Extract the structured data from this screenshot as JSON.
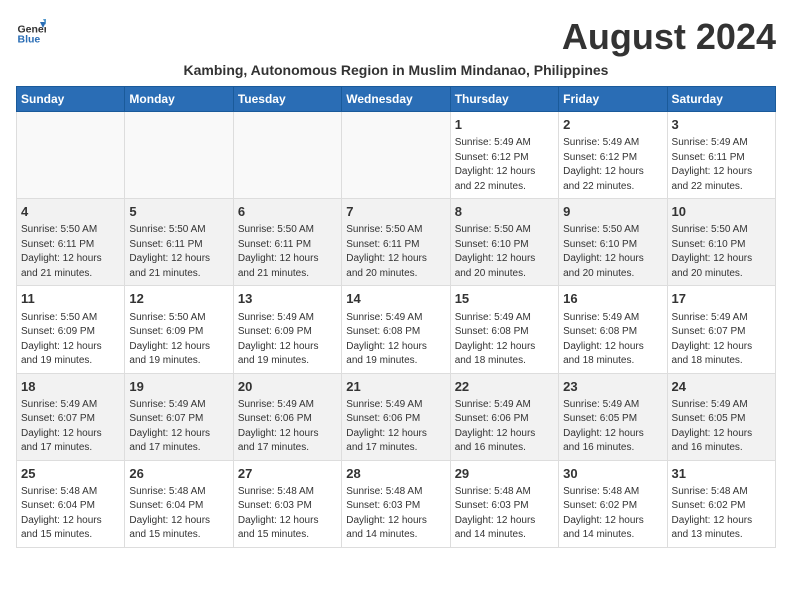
{
  "logo": {
    "text_general": "General",
    "text_blue": "Blue"
  },
  "title": "August 2024",
  "subtitle": "Kambing, Autonomous Region in Muslim Mindanao, Philippines",
  "days_of_week": [
    "Sunday",
    "Monday",
    "Tuesday",
    "Wednesday",
    "Thursday",
    "Friday",
    "Saturday"
  ],
  "weeks": [
    [
      {
        "day": "",
        "info": ""
      },
      {
        "day": "",
        "info": ""
      },
      {
        "day": "",
        "info": ""
      },
      {
        "day": "",
        "info": ""
      },
      {
        "day": "1",
        "info": "Sunrise: 5:49 AM\nSunset: 6:12 PM\nDaylight: 12 hours\nand 22 minutes."
      },
      {
        "day": "2",
        "info": "Sunrise: 5:49 AM\nSunset: 6:12 PM\nDaylight: 12 hours\nand 22 minutes."
      },
      {
        "day": "3",
        "info": "Sunrise: 5:49 AM\nSunset: 6:11 PM\nDaylight: 12 hours\nand 22 minutes."
      }
    ],
    [
      {
        "day": "4",
        "info": "Sunrise: 5:50 AM\nSunset: 6:11 PM\nDaylight: 12 hours\nand 21 minutes."
      },
      {
        "day": "5",
        "info": "Sunrise: 5:50 AM\nSunset: 6:11 PM\nDaylight: 12 hours\nand 21 minutes."
      },
      {
        "day": "6",
        "info": "Sunrise: 5:50 AM\nSunset: 6:11 PM\nDaylight: 12 hours\nand 21 minutes."
      },
      {
        "day": "7",
        "info": "Sunrise: 5:50 AM\nSunset: 6:11 PM\nDaylight: 12 hours\nand 20 minutes."
      },
      {
        "day": "8",
        "info": "Sunrise: 5:50 AM\nSunset: 6:10 PM\nDaylight: 12 hours\nand 20 minutes."
      },
      {
        "day": "9",
        "info": "Sunrise: 5:50 AM\nSunset: 6:10 PM\nDaylight: 12 hours\nand 20 minutes."
      },
      {
        "day": "10",
        "info": "Sunrise: 5:50 AM\nSunset: 6:10 PM\nDaylight: 12 hours\nand 20 minutes."
      }
    ],
    [
      {
        "day": "11",
        "info": "Sunrise: 5:50 AM\nSunset: 6:09 PM\nDaylight: 12 hours\nand 19 minutes."
      },
      {
        "day": "12",
        "info": "Sunrise: 5:50 AM\nSunset: 6:09 PM\nDaylight: 12 hours\nand 19 minutes."
      },
      {
        "day": "13",
        "info": "Sunrise: 5:49 AM\nSunset: 6:09 PM\nDaylight: 12 hours\nand 19 minutes."
      },
      {
        "day": "14",
        "info": "Sunrise: 5:49 AM\nSunset: 6:08 PM\nDaylight: 12 hours\nand 19 minutes."
      },
      {
        "day": "15",
        "info": "Sunrise: 5:49 AM\nSunset: 6:08 PM\nDaylight: 12 hours\nand 18 minutes."
      },
      {
        "day": "16",
        "info": "Sunrise: 5:49 AM\nSunset: 6:08 PM\nDaylight: 12 hours\nand 18 minutes."
      },
      {
        "day": "17",
        "info": "Sunrise: 5:49 AM\nSunset: 6:07 PM\nDaylight: 12 hours\nand 18 minutes."
      }
    ],
    [
      {
        "day": "18",
        "info": "Sunrise: 5:49 AM\nSunset: 6:07 PM\nDaylight: 12 hours\nand 17 minutes."
      },
      {
        "day": "19",
        "info": "Sunrise: 5:49 AM\nSunset: 6:07 PM\nDaylight: 12 hours\nand 17 minutes."
      },
      {
        "day": "20",
        "info": "Sunrise: 5:49 AM\nSunset: 6:06 PM\nDaylight: 12 hours\nand 17 minutes."
      },
      {
        "day": "21",
        "info": "Sunrise: 5:49 AM\nSunset: 6:06 PM\nDaylight: 12 hours\nand 17 minutes."
      },
      {
        "day": "22",
        "info": "Sunrise: 5:49 AM\nSunset: 6:06 PM\nDaylight: 12 hours\nand 16 minutes."
      },
      {
        "day": "23",
        "info": "Sunrise: 5:49 AM\nSunset: 6:05 PM\nDaylight: 12 hours\nand 16 minutes."
      },
      {
        "day": "24",
        "info": "Sunrise: 5:49 AM\nSunset: 6:05 PM\nDaylight: 12 hours\nand 16 minutes."
      }
    ],
    [
      {
        "day": "25",
        "info": "Sunrise: 5:48 AM\nSunset: 6:04 PM\nDaylight: 12 hours\nand 15 minutes."
      },
      {
        "day": "26",
        "info": "Sunrise: 5:48 AM\nSunset: 6:04 PM\nDaylight: 12 hours\nand 15 minutes."
      },
      {
        "day": "27",
        "info": "Sunrise: 5:48 AM\nSunset: 6:03 PM\nDaylight: 12 hours\nand 15 minutes."
      },
      {
        "day": "28",
        "info": "Sunrise: 5:48 AM\nSunset: 6:03 PM\nDaylight: 12 hours\nand 14 minutes."
      },
      {
        "day": "29",
        "info": "Sunrise: 5:48 AM\nSunset: 6:03 PM\nDaylight: 12 hours\nand 14 minutes."
      },
      {
        "day": "30",
        "info": "Sunrise: 5:48 AM\nSunset: 6:02 PM\nDaylight: 12 hours\nand 14 minutes."
      },
      {
        "day": "31",
        "info": "Sunrise: 5:48 AM\nSunset: 6:02 PM\nDaylight: 12 hours\nand 13 minutes."
      }
    ]
  ]
}
